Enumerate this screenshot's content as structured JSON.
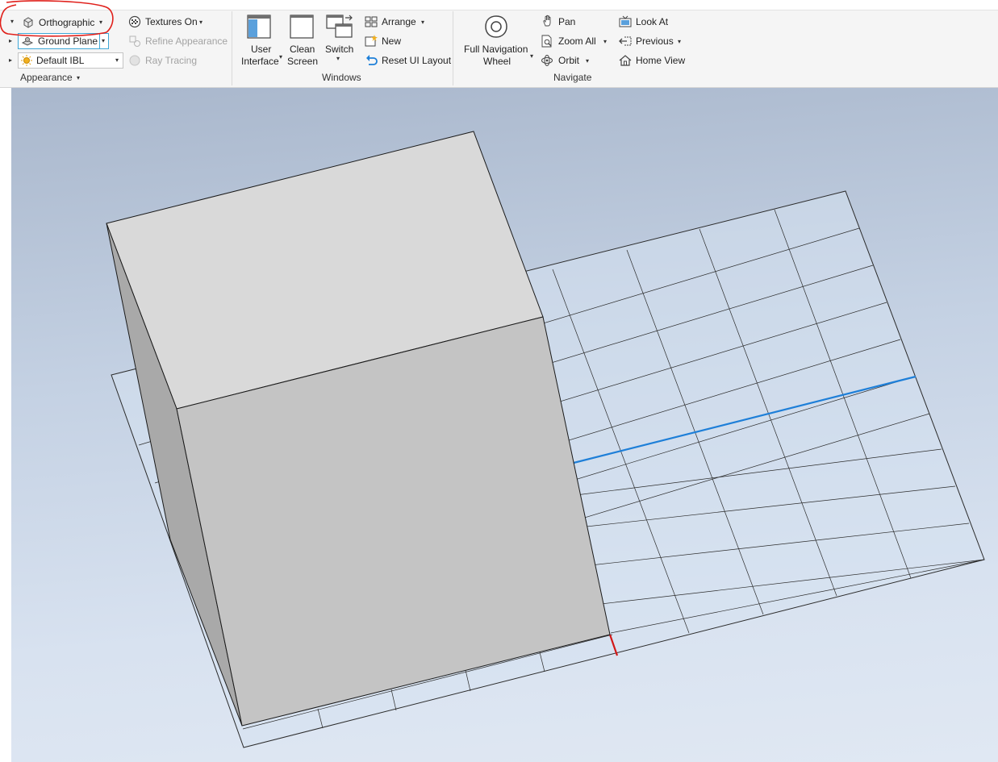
{
  "appearance": {
    "projection_label": "Orthographic",
    "ground_plane_label": "Ground Plane",
    "ibl_label": "Default IBL",
    "textures_label": "Textures On",
    "refine_label": "Refine Appearance",
    "raytracing_label": "Ray Tracing",
    "panel_title": "Appearance"
  },
  "windows": {
    "user_interface_line1": "User",
    "user_interface_line2": "Interface",
    "clean_screen_line1": "Clean",
    "clean_screen_line2": "Screen",
    "switch_label": "Switch",
    "arrange_label": "Arrange",
    "new_label": "New",
    "reset_label": "Reset UI Layout",
    "panel_title": "Windows"
  },
  "navigate": {
    "fnw_line1": "Full Navigation",
    "fnw_line2": "Wheel",
    "pan_label": "Pan",
    "zoom_all_label": "Zoom All",
    "orbit_label": "Orbit",
    "look_at_label": "Look At",
    "previous_label": "Previous",
    "home_view_label": "Home View",
    "panel_title": "Navigate"
  },
  "colors": {
    "annotation": "#e0201b",
    "accent_blue": "#1e7fd8",
    "axis_red": "#d21818"
  },
  "icons": [
    "cube-icon",
    "ground-plane-icon",
    "ibl-sun-icon",
    "textures-icon",
    "refine-icon",
    "ray-tracing-icon",
    "user-interface-icon",
    "clean-screen-icon",
    "switch-windows-icon",
    "arrange-icon",
    "new-window-icon",
    "reset-layout-icon",
    "navigation-wheel-icon",
    "pan-hand-icon",
    "zoom-all-icon",
    "orbit-icon",
    "look-at-icon",
    "previous-view-icon",
    "home-view-icon"
  ]
}
